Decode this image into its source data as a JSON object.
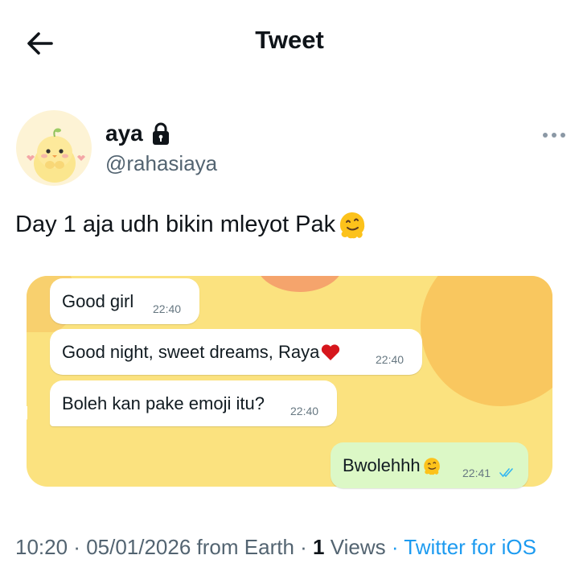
{
  "header": {
    "title": "Tweet",
    "back_icon": "arrow-left-icon"
  },
  "author": {
    "name": "aya",
    "handle": "@rahasiaya",
    "lock_icon": "lock-icon",
    "more_icon": "more-horizontal-icon"
  },
  "tweet": {
    "text": "Day 1 aja udh bikin mleyot Pak",
    "emoji": "melting-face-emoji"
  },
  "media": {
    "messages": [
      {
        "text": "Good girl",
        "time": "22:40",
        "direction": "incoming"
      },
      {
        "text": "Good night, sweet dreams, Raya",
        "time": "22:40",
        "direction": "incoming",
        "emoji": "heart-icon"
      },
      {
        "text": "Boleh kan pake emoji itu?",
        "time": "22:40",
        "direction": "incoming"
      },
      {
        "text": "Bwolehhh",
        "time": "22:41",
        "direction": "outgoing",
        "emoji": "melting-face-emoji",
        "status_icon": "double-check-icon"
      }
    ],
    "colors": {
      "background": "#fbe27f",
      "incoming": "#ffffff",
      "outgoing": "#dcf8c6",
      "tick": "#34b7f1"
    }
  },
  "meta": {
    "time": "10:20",
    "sep1": " · ",
    "date": "05/01/2026",
    "location": " from Earth · ",
    "views_count": "1",
    "views_label": " Views ",
    "sep2": "· ",
    "source": "Twitter for iOS"
  },
  "colors": {
    "link": "#1d9bf0",
    "secondary_text": "#536471"
  }
}
